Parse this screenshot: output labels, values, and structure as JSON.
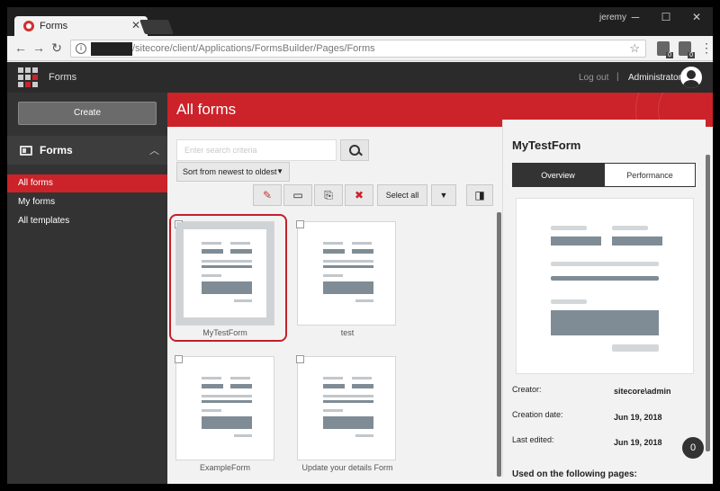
{
  "browser": {
    "tab_title": "Forms",
    "tab_close": "✕",
    "window_user": "jeremy",
    "url_path": "/sitecore/client/Applications/FormsBuilder/Pages/Forms",
    "ext_badge_1": "0",
    "ext_badge_2": "0"
  },
  "app": {
    "name": "Forms",
    "logout": "Log out",
    "separator": "|",
    "user": "Administrator"
  },
  "sidebar": {
    "create_label": "Create",
    "section_label": "Forms",
    "items": [
      {
        "label": "All forms",
        "active": true
      },
      {
        "label": "My forms",
        "active": false
      },
      {
        "label": "All templates",
        "active": false
      }
    ]
  },
  "main": {
    "title": "All forms",
    "search_placeholder": "Enter search criteria",
    "sort_label": "Sort from newest to oldest",
    "select_all_label": "Select all",
    "forms": [
      {
        "name": "MyTestForm",
        "selected": true
      },
      {
        "name": "test",
        "selected": false
      },
      {
        "name": "ExampleForm",
        "selected": false
      },
      {
        "name": "Update your details Form",
        "selected": false
      }
    ]
  },
  "panel": {
    "form_title": "MyTestForm",
    "tab_overview": "Overview",
    "tab_performance": "Performance",
    "creator_label": "Creator:",
    "creator_value": "sitecore\\admin",
    "created_label": "Creation date:",
    "created_value": "Jun 19, 2018",
    "edited_label": "Last edited:",
    "edited_value": "Jun 19, 2018",
    "used_on_heading": "Used on the following pages:",
    "count_badge": "0"
  },
  "colors": {
    "accent_red": "#cc2229",
    "header_dark": "#2b2b2b",
    "sidebar_dark": "#333333"
  }
}
